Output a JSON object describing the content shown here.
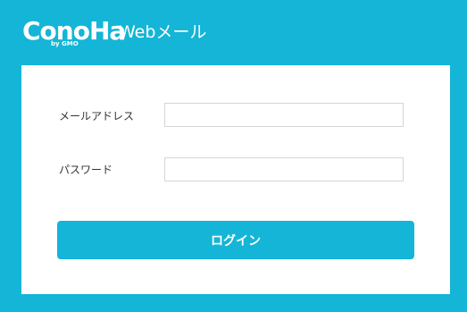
{
  "header": {
    "logo_text": "ConoHa",
    "logo_sub": "by GMO",
    "app_title": "Webメール"
  },
  "login_form": {
    "email_label": "メールアドレス",
    "email_value": "",
    "password_label": "パスワード",
    "password_value": "",
    "submit_label": "ログイン"
  },
  "colors": {
    "accent": "#14b5d7",
    "card": "#ffffff",
    "input_border": "#d6d6d6"
  }
}
